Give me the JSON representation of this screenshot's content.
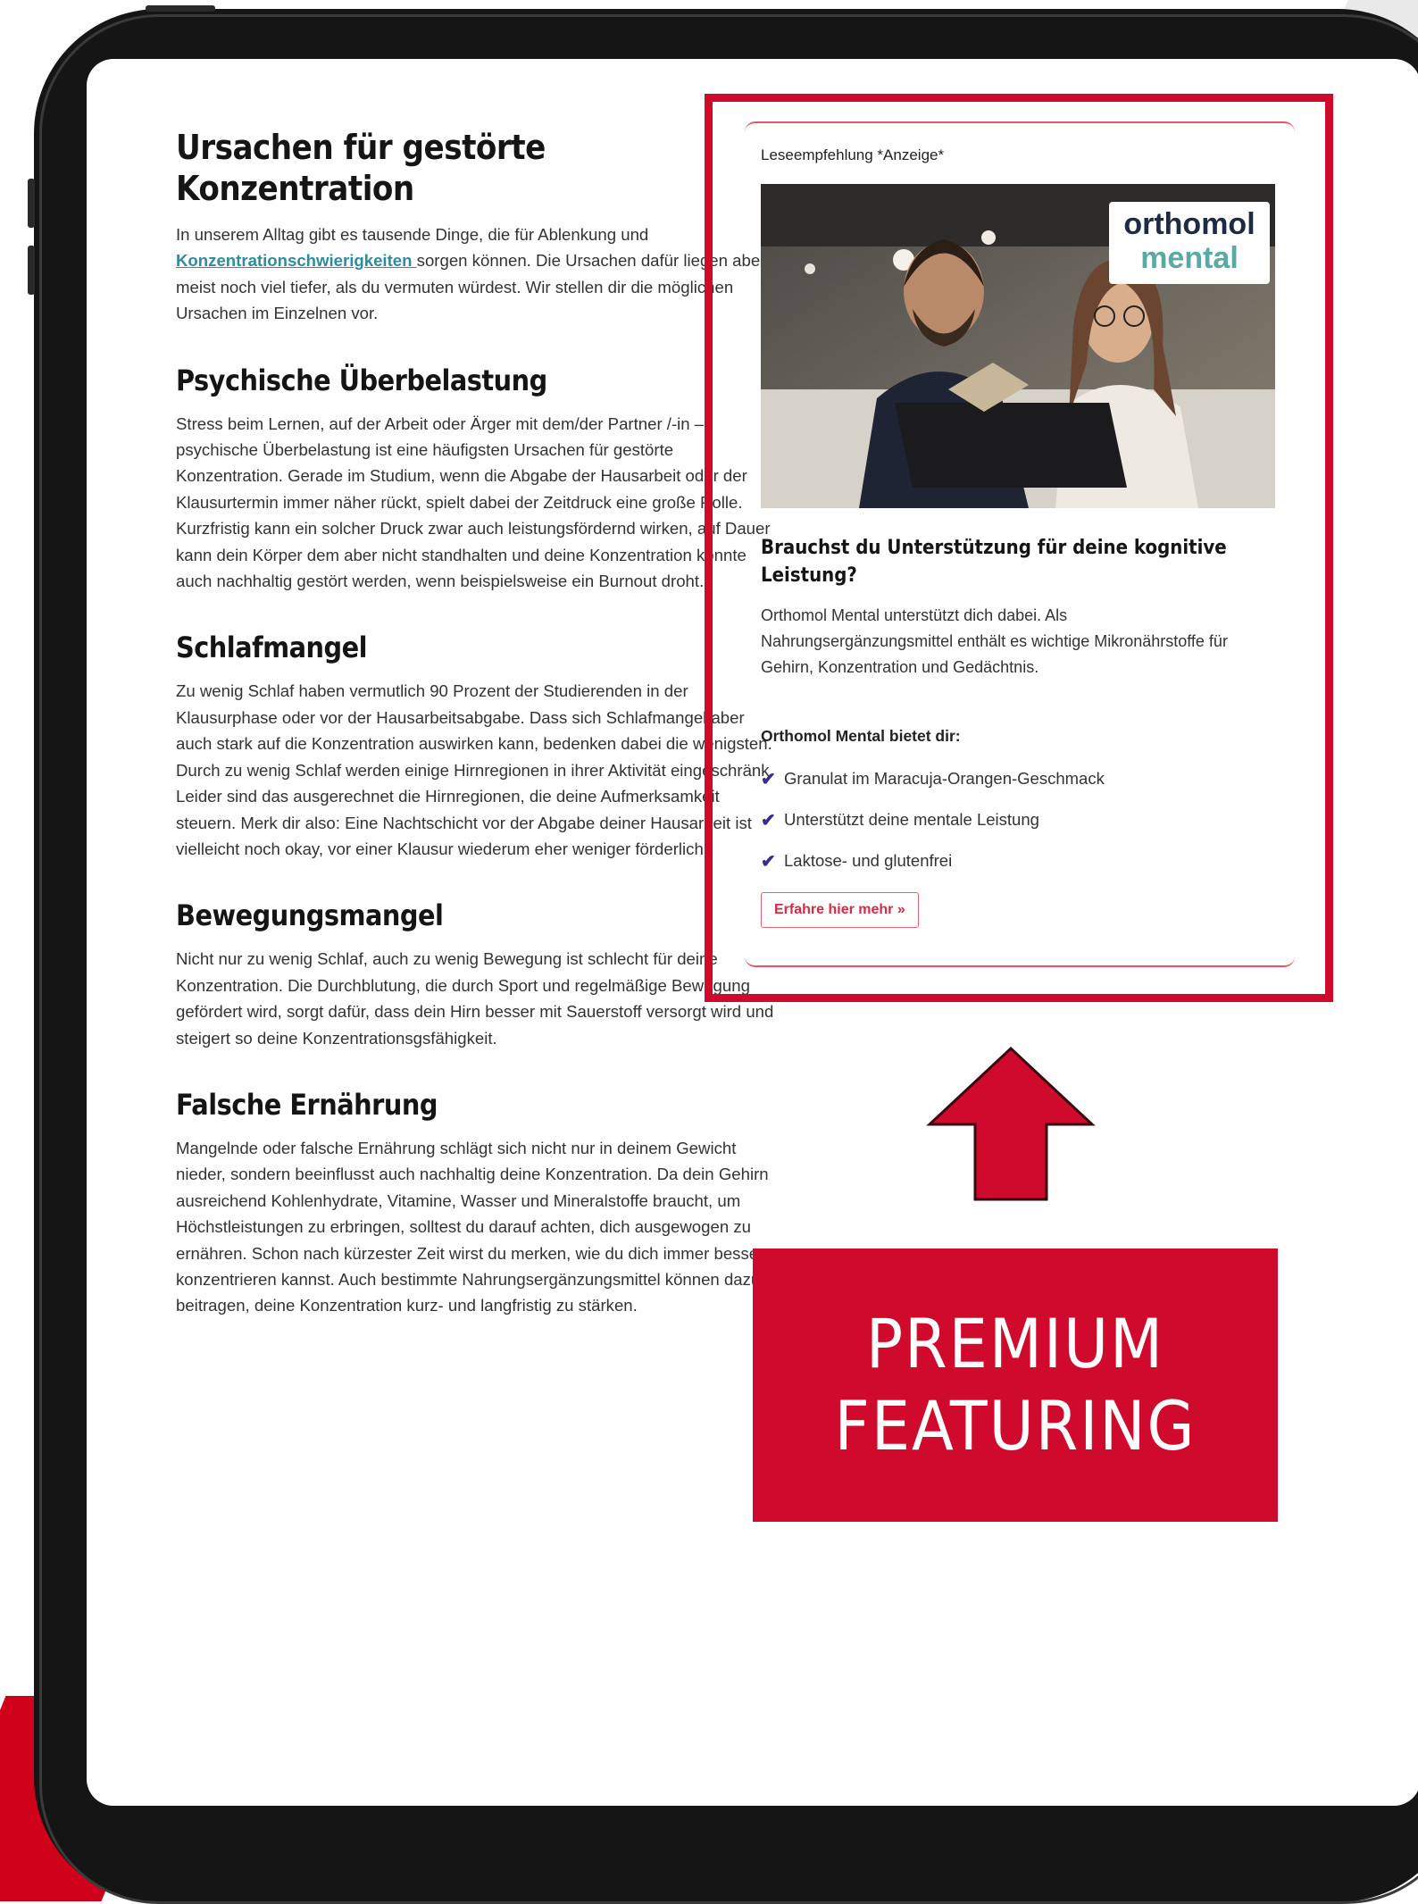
{
  "article": {
    "title": "Ursachen für gestörte Konzentration",
    "intro_pre": "In unserem Alltag gibt es tausende Dinge, die für Ablenkung und ",
    "intro_link": "Konzentrationschwierigkeiten ",
    "intro_post": "sorgen können. Die Ursachen dafür liegen aber meist noch viel tiefer, als du vermuten würdest. Wir stellen dir die möglichen Ursachen im Einzelnen vor.",
    "sections": [
      {
        "heading": "Psychische Überbelastung",
        "text": "Stress beim Lernen, auf der Arbeit oder Ärger mit dem/der Partner /-in – psychische Überbelastung ist eine häufigsten Ursachen für gestörte Konzentration. Gerade im Studium, wenn die Abgabe der Hausarbeit oder der Klausurtermin immer näher rückt, spielt dabei der Zeitdruck eine große Rolle. Kurzfristig kann ein solcher Druck zwar auch leistungsfördernd wirken, auf Dauer kann dein Körper dem aber nicht standhalten und deine Konzentration könnte auch nachhaltig gestört werden, wenn beispielsweise ein Burnout droht."
      },
      {
        "heading": "Schlafmangel",
        "text": "Zu wenig Schlaf haben vermutlich 90 Prozent der Studierenden in der Klausurphase oder vor der Hausarbeitsabgabe. Dass sich Schlafmangel aber auch stark auf die Konzentration auswirken kann, bedenken dabei die wenigsten. Durch zu wenig Schlaf werden einige Hirnregionen in ihrer Aktivität eingeschränk. Leider sind das ausgerechnet die Hirnregionen, die deine Aufmerksamkeit steuern. Merk dir also: Eine Nachtschicht vor der Abgabe deiner Hausarbeit ist vielleicht noch okay, vor einer Klausur wiederum eher weniger förderlich."
      },
      {
        "heading": "Bewegungsmangel",
        "text": "Nicht nur zu wenig Schlaf, auch zu wenig Bewegung ist schlecht für deine Konzentration. Die Durchblutung, die durch Sport und regelmäßige Bewegung gefördert wird, sorgt dafür, dass dein Hirn besser mit Sauerstoff versorgt wird und steigert so deine Konzentrationsgsfähigkeit."
      },
      {
        "heading": "Falsche Ernährung",
        "text": "Mangelnde oder falsche Ernährung schlägt sich nicht nur in deinem Gewicht nieder, sondern beeinflusst auch nachhaltig deine Konzentration. Da dein Gehirn ausreichend Kohlenhydrate, Vitamine, Wasser und Mineralstoffe braucht, um Höchstleistungen zu erbringen, solltest du darauf achten, dich ausgewogen zu ernähren. Schon nach kürzester Zeit wirst du merken, wie du dich immer besser konzentrieren kannst. Auch bestimmte Nahrungsergänzungsmittel können dazu beitragen, deine Konzentration kurz- und langfristig zu stärken."
      }
    ]
  },
  "ad": {
    "label": "Leseempfehlung *Anzeige*",
    "logo_line1": "orthomol",
    "logo_line2": "mental",
    "title": "Brauchst du Unterstützung für deine kognitive Leistung?",
    "text": "Orthomol Mental unterstützt dich dabei. Als Nahrungsergänzungsmittel enthält es wichtige Mikronährstoffe für Gehirn, Konzentration und Gedächtnis.",
    "subheading": "Orthomol Mental bietet dir:",
    "features": [
      "Granulat im Maracuja-Orangen-Geschmack",
      "Unterstützt deine mentale Leistung",
      "Laktose- und glutenfrei"
    ],
    "check_icon": "✔",
    "button": "Erfahre hier mehr »"
  },
  "premium": {
    "line1": "PREMIUM",
    "line2": "FEATURING"
  },
  "colors": {
    "accent_red": "#cf0a2c",
    "link_teal": "#2e8c9e",
    "check_purple": "#3e2a8a",
    "logo_dark": "#1f2a44",
    "logo_teal": "#5aa9a3"
  }
}
